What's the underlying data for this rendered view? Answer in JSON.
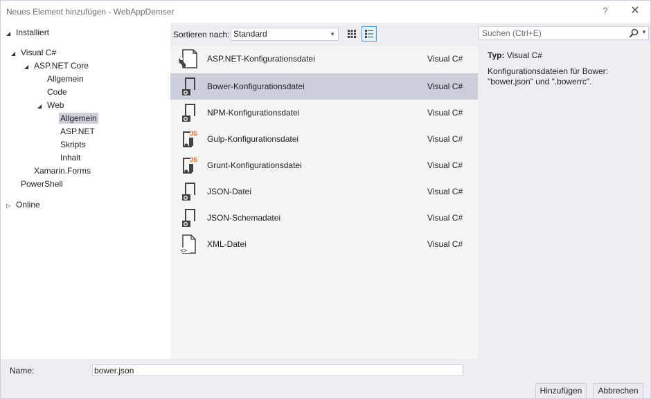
{
  "window": {
    "title": "Neues Element hinzufügen - WebAppDemser",
    "help_glyph": "?",
    "close_glyph": "✕"
  },
  "tree": [
    {
      "id": "installiert",
      "label": "Installiert",
      "expanded": true
    },
    {
      "id": "visual-csharp",
      "label": "Visual C#",
      "expanded": true
    },
    {
      "id": "aspnet-core",
      "label": "ASP.NET Core",
      "expanded": true
    },
    {
      "id": "allgemein-1",
      "label": "Allgemein"
    },
    {
      "id": "code",
      "label": "Code"
    },
    {
      "id": "web",
      "label": "Web",
      "expanded": true
    },
    {
      "id": "allgemein-2",
      "label": "Allgemein",
      "selected": true
    },
    {
      "id": "aspnet",
      "label": "ASP.NET"
    },
    {
      "id": "skripts",
      "label": "Skripts"
    },
    {
      "id": "inhalt",
      "label": "Inhalt"
    },
    {
      "id": "xamarin-forms",
      "label": "Xamarin.Forms"
    },
    {
      "id": "powershell",
      "label": "PowerShell"
    },
    {
      "id": "online",
      "label": "Online",
      "expanded": false
    }
  ],
  "sort": {
    "label": "Sortieren nach:",
    "value": "Standard"
  },
  "items": [
    {
      "name": "ASP.NET-Konfigurationsdatei",
      "lang": "Visual C#",
      "icon": "config-file-icon"
    },
    {
      "name": "Bower-Konfigurationsdatei",
      "lang": "Visual C#",
      "icon": "json-file-icon",
      "selected": true
    },
    {
      "name": "NPM-Konfigurationsdatei",
      "lang": "Visual C#",
      "icon": "json-file-icon"
    },
    {
      "name": "Gulp-Konfigurationsdatei",
      "lang": "Visual C#",
      "icon": "js-file-icon",
      "badge": "JS"
    },
    {
      "name": "Grunt-Konfigurationsdatei",
      "lang": "Visual C#",
      "icon": "js-file-icon",
      "badge": "JS"
    },
    {
      "name": "JSON-Datei",
      "lang": "Visual C#",
      "icon": "json-file-icon"
    },
    {
      "name": "JSON-Schemadatei",
      "lang": "Visual C#",
      "icon": "json-file-icon"
    },
    {
      "name": "XML-Datei",
      "lang": "Visual C#",
      "icon": "xml-file-icon",
      "badge": "<>"
    }
  ],
  "search": {
    "placeholder": "Suchen (Ctrl+E)"
  },
  "details": {
    "type_label": "Typ:",
    "type_value": "Visual C#",
    "description": "Konfigurationsdateien für Bower: \"bower.json\" und \".bowerrc\"."
  },
  "bottom": {
    "name_label": "Name:",
    "name_value": "bower.json",
    "add_label": "Hinzufügen",
    "cancel_label": "Abbrechen"
  },
  "colors": {
    "selection": "#cccedb",
    "js_badge": "#e46c1c",
    "accent": "#3399ff"
  }
}
